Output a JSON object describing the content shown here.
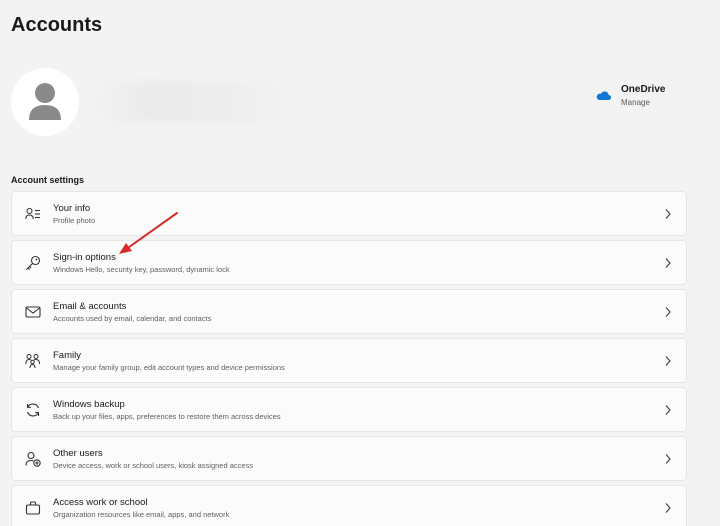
{
  "page": {
    "title": "Accounts"
  },
  "profile": {
    "avatar_icon": "person-icon"
  },
  "onedrive": {
    "title": "OneDrive",
    "subtitle": "Manage",
    "icon": "cloud-icon",
    "icon_color": "#0f78d4"
  },
  "section": {
    "label": "Account settings"
  },
  "items": [
    {
      "title": "Your info",
      "subtitle": "Profile photo",
      "icon": "person-info-icon"
    },
    {
      "title": "Sign-in options",
      "subtitle": "Windows Hello, security key, password, dynamic lock",
      "icon": "key-icon"
    },
    {
      "title": "Email & accounts",
      "subtitle": "Accounts used by email, calendar, and contacts",
      "icon": "mail-icon"
    },
    {
      "title": "Family",
      "subtitle": "Manage your family group, edit account types and device permissions",
      "icon": "family-icon"
    },
    {
      "title": "Windows backup",
      "subtitle": "Back up your files, apps, preferences to restore them across devices",
      "icon": "sync-icon"
    },
    {
      "title": "Other users",
      "subtitle": "Device access, work or school users, kiosk assigned access",
      "icon": "add-user-icon"
    },
    {
      "title": "Access work or school",
      "subtitle": "Organization resources like email, apps, and network",
      "icon": "briefcase-icon"
    }
  ],
  "annotation": {
    "arrow_color": "#d62b2b"
  }
}
